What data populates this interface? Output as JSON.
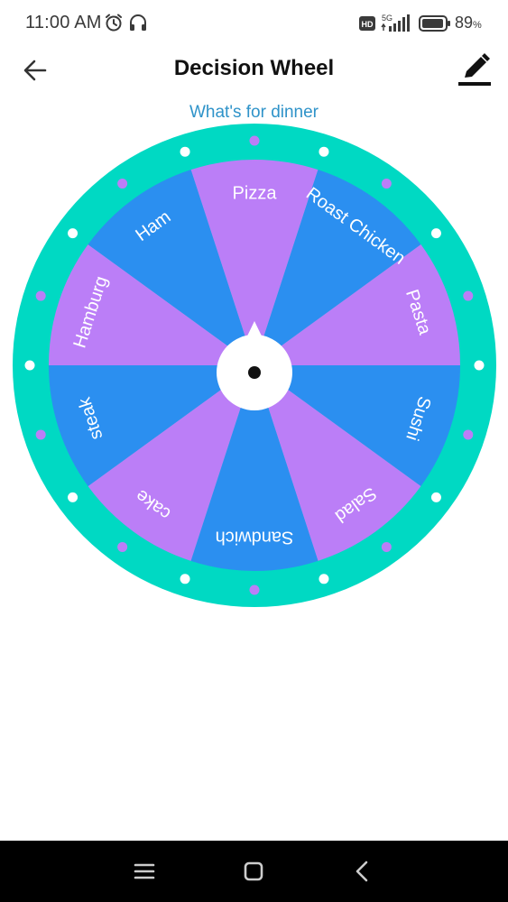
{
  "status_bar": {
    "time": "11:00 AM",
    "battery_level": "89",
    "battery_unit": "%",
    "network_label": "5G",
    "hd_badge": "HD",
    "icons": [
      "alarm-icon",
      "headset-icon",
      "hd-icon",
      "signal-icon",
      "battery-icon"
    ]
  },
  "app_bar": {
    "title": "Decision Wheel",
    "back_icon": "arrow-left-icon",
    "edit_icon": "pencil-icon"
  },
  "wheel": {
    "question": "What's for dinner",
    "options": [
      "Pizza",
      "Roast Chicken",
      "Pasta",
      "Sushi",
      "Salad",
      "Sandwich",
      "cake",
      "steak",
      "Hamburg",
      "Ham"
    ],
    "colors": {
      "rim": "#00d9c3",
      "slice_a": "#bb7ef7",
      "slice_b": "#2b8ff0",
      "dot_white": "#ffffff",
      "dot_purple": "#bb7ef7",
      "hub": "#ffffff",
      "hub_center": "#111111",
      "label": "#ffffff"
    }
  },
  "nav_bar": {
    "buttons": [
      "menu-icon",
      "home-icon",
      "back-icon"
    ]
  }
}
